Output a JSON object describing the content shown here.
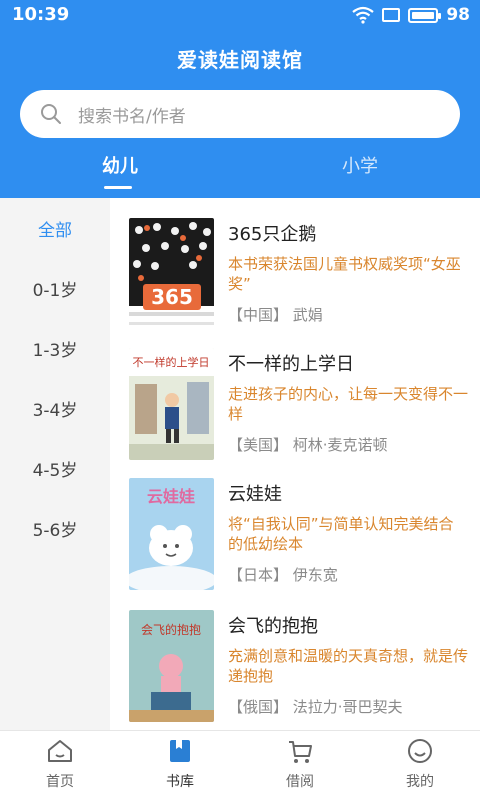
{
  "status": {
    "time": "10:39",
    "battery": "98",
    "battery_level": 0.98
  },
  "app": {
    "title": "爱读娃阅读馆"
  },
  "search": {
    "placeholder": "搜索书名/作者"
  },
  "tabs": [
    {
      "label": "幼儿",
      "active": true
    },
    {
      "label": "小学",
      "active": false
    }
  ],
  "sidebar": {
    "items": [
      {
        "label": "全部",
        "active": true
      },
      {
        "label": "0-1岁"
      },
      {
        "label": "1-3岁"
      },
      {
        "label": "3-4岁"
      },
      {
        "label": "4-5岁"
      },
      {
        "label": "5-6岁"
      }
    ]
  },
  "books": [
    {
      "title": "365只企鹅",
      "desc": "本书荣获法国儿童书权威奖项“女巫奖”",
      "author": "【中国】 武娟",
      "cover_text": "365"
    },
    {
      "title": "不一样的上学日",
      "desc": "走进孩子的内心，让每一天变得不一样",
      "author": "【美国】 柯林·麦克诺顿",
      "cover_text": "不一样的上学日"
    },
    {
      "title": "云娃娃",
      "desc": "将“自我认同”与简单认知完美结合的低幼绘本",
      "author": "【日本】 伊东宽",
      "cover_text": "云娃娃"
    },
    {
      "title": "会飞的抱抱",
      "desc": "充满创意和温暖的天真奇想，就是传递抱抱",
      "author": "【俄国】 法拉力·哥巴契夫",
      "cover_text": "会飞的抱抱"
    }
  ],
  "tabbar": {
    "items": [
      {
        "label": "首页",
        "icon": "home-icon"
      },
      {
        "label": "书库",
        "icon": "library-icon",
        "active": true
      },
      {
        "label": "借阅",
        "icon": "cart-icon"
      },
      {
        "label": "我的",
        "icon": "profile-icon"
      }
    ]
  },
  "colors": {
    "primary": "#2f8ef0",
    "accent_text": "#d9862e",
    "muted": "#8a8a8a"
  }
}
